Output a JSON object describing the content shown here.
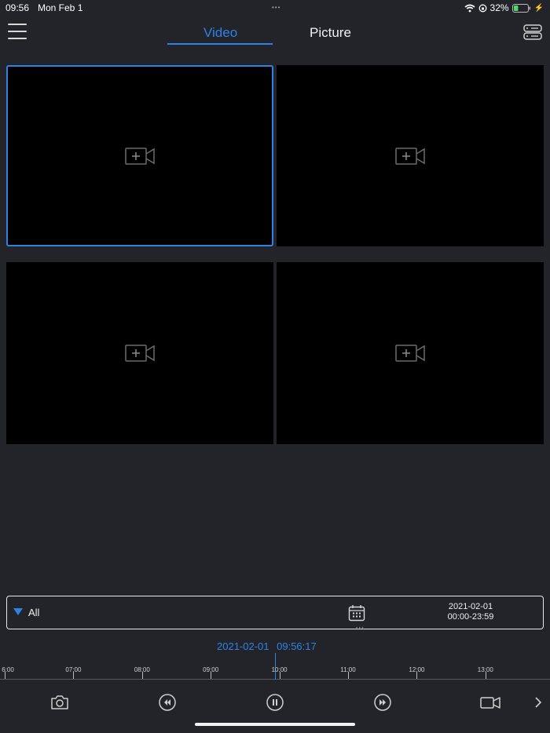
{
  "status_bar": {
    "time": "09:56",
    "date": "Mon Feb 1",
    "battery": "32%",
    "battery_level": 0.32
  },
  "nav": {
    "tabs": [
      {
        "label": "Video",
        "active": true
      },
      {
        "label": "Picture",
        "active": false
      }
    ],
    "menu_icon": "hamburger-menu-icon",
    "server_icon": "server-list-icon"
  },
  "video_grid": {
    "cells": [
      {
        "selected": true,
        "icon": "add-camera-icon"
      },
      {
        "selected": false,
        "icon": "add-camera-icon"
      },
      {
        "selected": false,
        "icon": "add-camera-icon"
      },
      {
        "selected": false,
        "icon": "add-camera-icon"
      }
    ]
  },
  "filter": {
    "type_label": "All",
    "date": "2021-02-01",
    "time_range": "00:00-23:59",
    "calendar_icon": "calendar-icon"
  },
  "playback": {
    "date": "2021-02-01",
    "time": "09:56:17"
  },
  "timeline": {
    "hours": [
      "6:00",
      "07:00",
      "08:00",
      "09:00",
      "10:00",
      "11:00",
      "12:00",
      "13:00"
    ],
    "current_hour_value": 9.938
  },
  "controls": [
    {
      "icon": "snapshot-camera-icon"
    },
    {
      "icon": "rewind-icon"
    },
    {
      "icon": "pause-icon"
    },
    {
      "icon": "fast-forward-icon"
    },
    {
      "icon": "record-video-icon"
    },
    {
      "icon": "chevron-right-icon"
    }
  ],
  "colors": {
    "accent": "#2e82e6",
    "background": "#23242a",
    "cell": "#000000"
  }
}
